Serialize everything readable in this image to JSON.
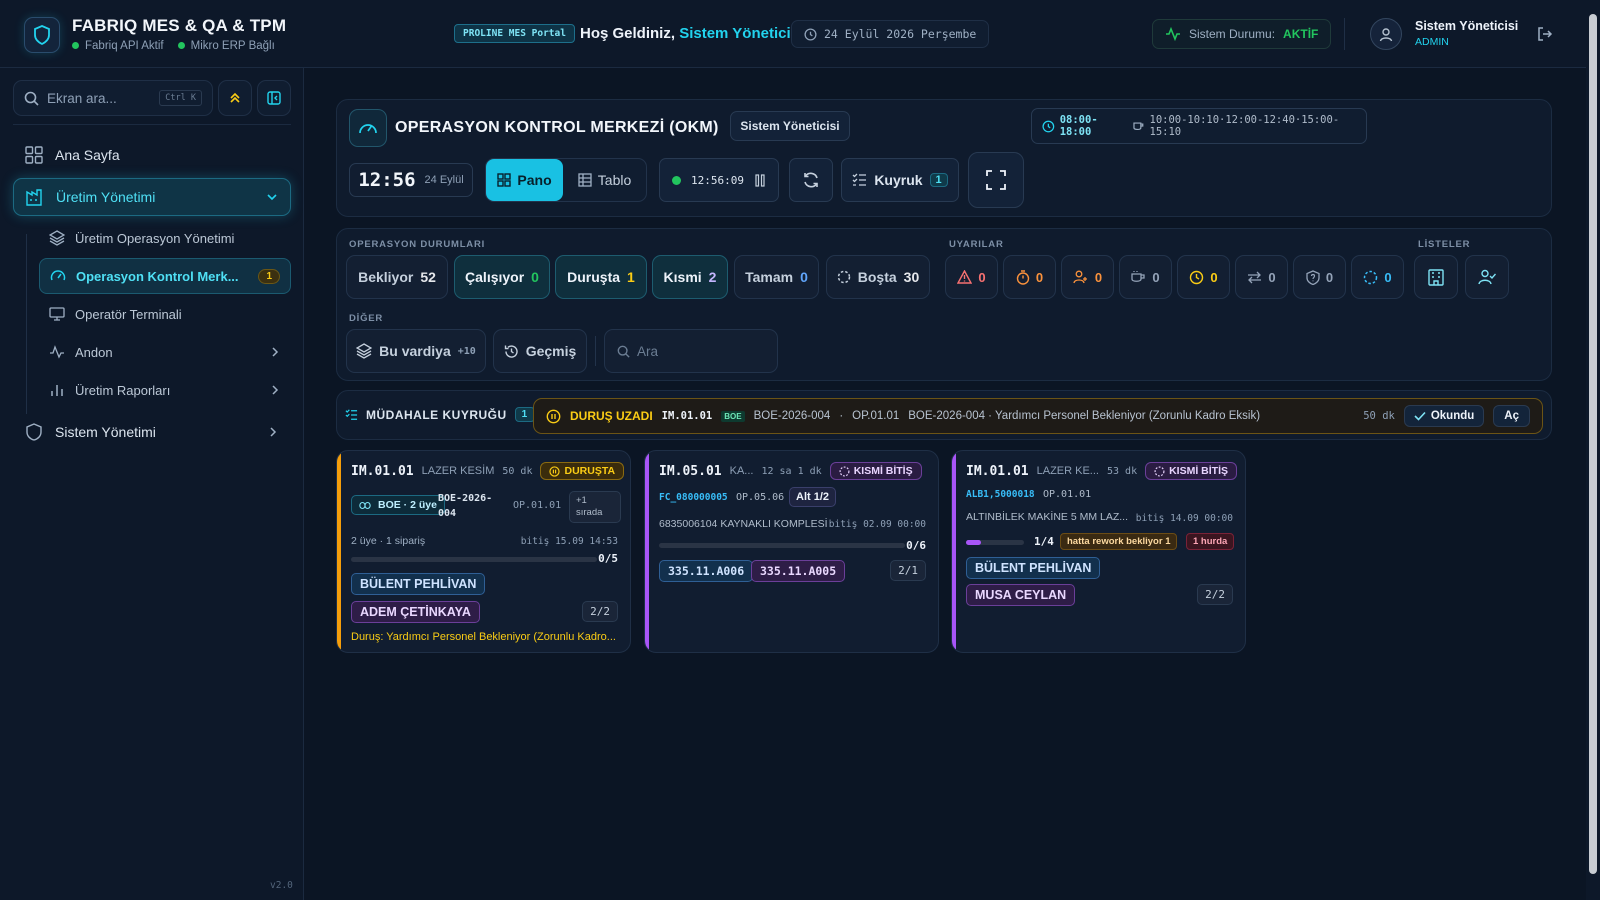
{
  "topbar": {
    "brand_title": "FABRIQ MES & QA & TPM",
    "status_api": "Fabriq API Aktif",
    "status_erp": "Mikro ERP Bağlı",
    "portal_badge": "PROLINE MES Portal",
    "welcome_prefix": "Hoş Geldiniz,",
    "welcome_user": "Sistem Yöneticisi",
    "date": "24 Eylül 2026 Perşembe",
    "system_status_label": "Sistem Durumu:",
    "system_status_value": "AKTİF",
    "user_name": "Sistem Yöneticisi",
    "user_role": "ADMIN"
  },
  "sidebar": {
    "search_placeholder": "Ekran ara...",
    "search_shortcut": "Ctrl K",
    "items": [
      {
        "label": "Ana Sayfa"
      },
      {
        "label": "Üretim Yönetimi"
      },
      {
        "label": "Sistem Yönetimi"
      }
    ],
    "sub_items": [
      {
        "label": "Üretim Operasyon Yönetimi"
      },
      {
        "label": "Operasyon Kontrol Merk...",
        "count": "1"
      },
      {
        "label": "Operatör Terminali"
      },
      {
        "label": "Andon"
      },
      {
        "label": "Üretim Raporları"
      }
    ],
    "version": "v2.0"
  },
  "okm": {
    "title": "OPERASYON KONTROL MERKEZİ (OKM)",
    "user_chip": "Sistem Yöneticisi",
    "shift_hours": "08:00-18:00",
    "breaks": "10:00-10:10·12:00-12:40·15:00-15:10",
    "clock": "12:56",
    "clock_date": "24 Eylül",
    "view_pano": "Pano",
    "view_tablo": "Tablo",
    "live_time": "12:56:09",
    "queue_label": "Kuyruk",
    "queue_count": "1"
  },
  "filters": {
    "section_states": "OPERASYON DURUMLARI",
    "section_alerts": "UYARILAR",
    "section_lists": "LİSTELER",
    "section_other": "DİĞER",
    "states": [
      {
        "label": "Bekliyor",
        "count": "52",
        "color": "#e5e7eb"
      },
      {
        "label": "Çalışıyor",
        "count": "0",
        "color": "#22c55e"
      },
      {
        "label": "Duruşta",
        "count": "1",
        "color": "#facc15"
      },
      {
        "label": "Kısmi",
        "count": "2",
        "color": "#c4b5fd"
      },
      {
        "label": "Tamam",
        "count": "0",
        "color": "#60a5fa"
      },
      {
        "label": "Boşta",
        "count": "30",
        "color": "#e5e7eb"
      }
    ],
    "alerts": [
      {
        "icon": "warning-triangle-icon",
        "count": "0",
        "color": "#f87171"
      },
      {
        "icon": "stopwatch-icon",
        "count": "0",
        "color": "#fb923c"
      },
      {
        "icon": "users-icon",
        "count": "0",
        "color": "#fb923c"
      },
      {
        "icon": "coffee-icon",
        "count": "0",
        "color": "#94a3b8"
      },
      {
        "icon": "clock-icon",
        "count": "0",
        "color": "#facc15"
      },
      {
        "icon": "swap-icon",
        "count": "0",
        "color": "#94a3b8"
      },
      {
        "icon": "shield-question-icon",
        "count": "0",
        "color": "#94a3b8"
      },
      {
        "icon": "spinner-icon",
        "count": "0",
        "color": "#38bdf8"
      }
    ],
    "shift_label": "Bu vardiya",
    "shift_extra": "+10",
    "history_label": "Geçmiş",
    "search_placeholder": "Ara"
  },
  "queue": {
    "title": "MÜDAHALE KUYRUĞU",
    "count": "1",
    "item_type": "DURUŞ UZADI",
    "item_machine": "IM.01.01",
    "item_boe": "BOE",
    "item_order": "BOE-2026-004",
    "item_sep": "·",
    "item_op": "OP.01.01",
    "item_desc": "BOE-2026-004 · Yardımcı Personel Bekleniyor (Zorunlu Kadro Eksik)",
    "item_time": "50 dk",
    "ack_label": "Okundu",
    "open_label": "Aç"
  },
  "cards": [
    {
      "machine": "IM.01.01",
      "process": "LAZER KESİM",
      "duration": "50 dk",
      "status": "DURUŞTA",
      "group_label": "BOE · 2 üye",
      "order": "BOE-2026-004",
      "op": "OP.01.01",
      "queue_note": "+1 sırada",
      "meta": "2 üye · 1 sipariş",
      "end": "bitiş 15.09 14:53",
      "progress_text": "0/5",
      "progress_fraction": 0,
      "operators": [
        "BÜLENT PEHLİVAN",
        "ADEM ÇETİNKAYA"
      ],
      "operator_count": "2/2",
      "stop_reason": "Duruş: Yardımcı Personel Bekleniyor (Zorunlu Kadro..."
    },
    {
      "machine": "IM.05.01",
      "process": "KA...",
      "duration": "12 sa 1 dk",
      "status": "KISMİ BİTİŞ",
      "product_code": "FC_080000005",
      "op": "OP.05.06",
      "alt": "Alt 1/2",
      "product_name": "6835006104 KAYNAKLI KOMPLESİ",
      "end": "bitiş 02.09 00:00",
      "progress_text": "0/6",
      "progress_fraction": 0,
      "lots": [
        "335.11.A006",
        "335.11.A005"
      ],
      "lot_count": "2/1"
    },
    {
      "machine": "IM.01.01",
      "process": "LAZER KE...",
      "duration": "53 dk",
      "status": "KISMİ BİTİŞ",
      "product_code": "ALB1,5000018",
      "op": "OP.01.01",
      "product_name": "ALTINBİLEK MAKİNE 5 MM LAZ...",
      "end": "bitiş 14.09 00:00",
      "progress_text": "1/4",
      "progress_fraction": 0.25,
      "rework": "hatta rework bekliyor 1",
      "scrap": "1 hurda",
      "operators": [
        "BÜLENT PEHLİVAN",
        "MUSA CEYLAN"
      ],
      "operator_count": "2/2"
    }
  ]
}
